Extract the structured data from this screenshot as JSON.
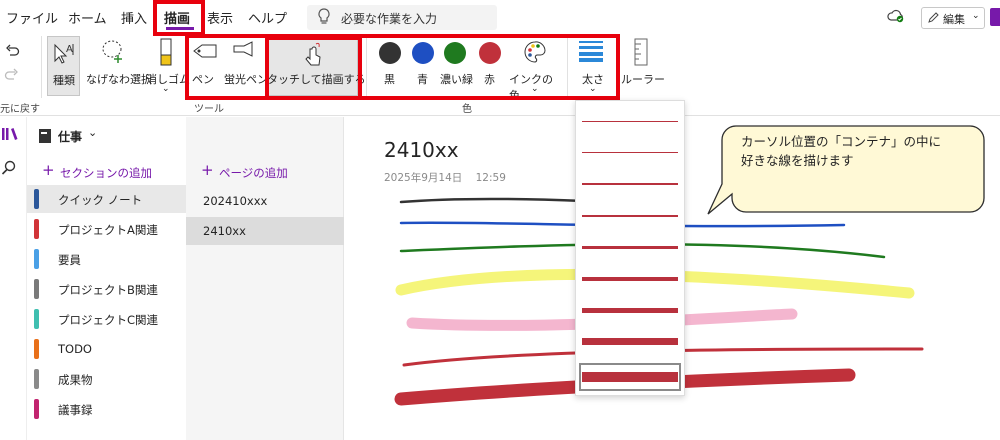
{
  "menu": {
    "items": [
      "ファイル",
      "ホーム",
      "挿入",
      "描画",
      "表示",
      "ヘルプ"
    ],
    "search_placeholder": "必要な作業を入力",
    "edit_label": "編集"
  },
  "ribbon": {
    "undo_group_label": "元に戻す",
    "tools": {
      "type_label": "種類",
      "lasso_label": "なげなわ選択",
      "eraser_label": "消しゴム",
      "pen_label": "ペン",
      "highlighter_label": "蛍光ペン",
      "touch_draw_label": "タッチして描画する",
      "group_label": "ツール"
    },
    "colors": {
      "black_label": "黒",
      "blue_label": "青",
      "green_label": "濃い緑",
      "red_label": "赤",
      "ink_color_label": "インクの色",
      "group_label": "色",
      "black": "#333333",
      "blue": "#1e4fc2",
      "green": "#1f7a1f",
      "red": "#c0313b"
    },
    "thickness_label": "太さ",
    "ruler_label": "ルーラー"
  },
  "notebook": {
    "name": "仕事",
    "add_section": "セクションの追加",
    "add_page": "ページの追加",
    "sections": [
      {
        "label": "クイック ノート",
        "color": "#2b579a"
      },
      {
        "label": "プロジェクトA関連",
        "color": "#d13438"
      },
      {
        "label": "要員",
        "color": "#4aa0e6"
      },
      {
        "label": "プロジェクトB関連",
        "color": "#7a7a7a"
      },
      {
        "label": "プロジェクトC関連",
        "color": "#3fbfb0"
      },
      {
        "label": "TODO",
        "color": "#e8701a"
      },
      {
        "label": "成果物",
        "color": "#8a8a8a"
      },
      {
        "label": "議事録",
        "color": "#c2246f"
      }
    ],
    "pages": [
      "202410xxx",
      "2410xx"
    ]
  },
  "page": {
    "title": "2410xx",
    "date": "2025年9月14日",
    "time": "12:59"
  },
  "callout": {
    "line1": "カーソル位置の「コンテナ」の中に",
    "line2": "好きな線を描けます"
  }
}
